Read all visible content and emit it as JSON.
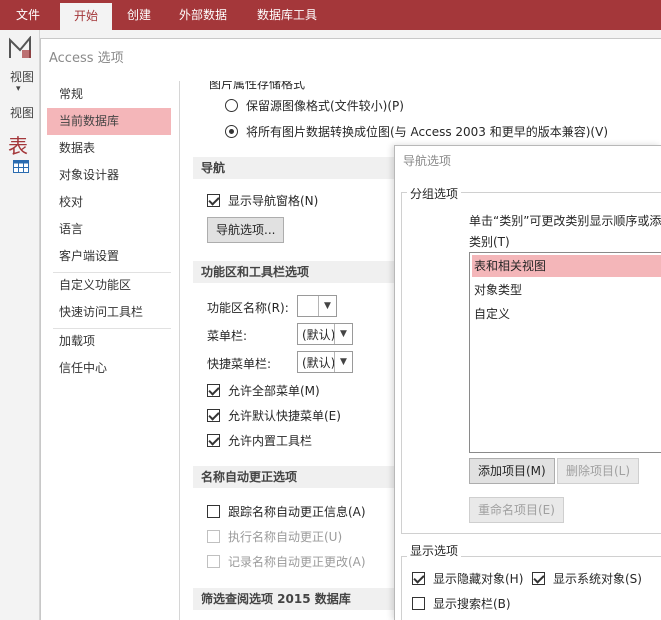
{
  "ribbon": {
    "tabs": [
      {
        "label": "文件",
        "active": false
      },
      {
        "label": "开始",
        "active": true
      },
      {
        "label": "创建",
        "active": false
      },
      {
        "label": "外部数据",
        "active": false
      },
      {
        "label": "数据库工具",
        "active": false
      }
    ]
  },
  "leftstrip": {
    "view_label": "视图",
    "view_label2": "视图",
    "table_label": "表"
  },
  "options_dialog": {
    "title": "Access 选项",
    "categories": [
      "常规",
      "当前数据库",
      "数据表",
      "对象设计器",
      "校对",
      "语言",
      "客户端设置",
      "自定义功能区",
      "快速访问工具栏",
      "加载项",
      "信任中心"
    ],
    "selected_category": "当前数据库",
    "picture_format": {
      "heading": "图片属性存储格式",
      "option1": "保留源图像格式(文件较小)(P)",
      "option2": "将所有图片数据转换成位图(与 Access 2003 和更早的版本兼容)(V)",
      "selected": 2
    },
    "navigation": {
      "heading": "导航",
      "show_nav_pane": "显示导航窗格(N)",
      "nav_options_button": "导航选项..."
    },
    "ribbon_toolbar": {
      "heading": "功能区和工具栏选项",
      "ribbon_name_label": "功能区名称(R):",
      "ribbon_name_value": "",
      "menu_bar_label": "菜单栏:",
      "menu_bar_value": "(默认)",
      "shortcut_menu_label": "快捷菜单栏:",
      "shortcut_menu_value": "(默认)",
      "allow_full_menus": "允许全部菜单(M)",
      "allow_default_shortcut": "允许默认快捷菜单(E)",
      "allow_builtin_toolbars": "允许内置工具栏"
    },
    "autocorrect": {
      "heading": "名称自动更正选项",
      "track": "跟踪名称自动更正信息(A)",
      "perform": "执行名称自动更正(U)",
      "log": "记录名称自动更正更改(A)"
    },
    "filter": {
      "heading": "筛选查阅选项 2015 数据库"
    }
  },
  "nav_dialog": {
    "title": "导航选项",
    "grouping": {
      "legend": "分组选项",
      "hint": "单击“类别”可更改类别显示顺序或添",
      "category_label": "类别(T)",
      "items": [
        "表和相关视图",
        "对象类型",
        "自定义"
      ],
      "selected": "表和相关视图",
      "add_item": "添加项目(M)",
      "delete_item": "删除项目(L)",
      "rename_item": "重命名项目(E)"
    },
    "display": {
      "legend": "显示选项",
      "show_hidden": "显示隐藏对象(H)",
      "show_system": "显示系统对象(S)",
      "show_search": "显示搜索栏(B)"
    }
  },
  "colors": {
    "accent": "#a4373a",
    "selection": "#f4b6b9"
  }
}
